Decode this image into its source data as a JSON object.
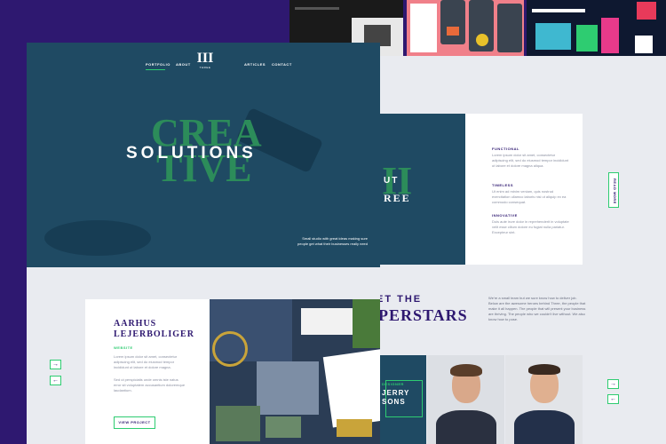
{
  "nav": {
    "portfolio": "PORTFOLIO",
    "about": "ABOUT",
    "articles": "ARTICLES",
    "contact": "CONTACT",
    "logo_mark": "III",
    "logo_text": "THREE"
  },
  "hero": {
    "headline": "SOLUTIONS",
    "bg_word_1": "CREA",
    "bg_word_2": "TIVE",
    "tagline": "Small studio with great ideas making sure people get what their businesses really need"
  },
  "about": {
    "partial_heading_1": "UT",
    "partial_heading_2": "REE",
    "items": [
      {
        "title": "FUNCTIONAL",
        "body": "Lorem ipsum dolor sit amet, consectetur adipiscing elit, sed do eiusmod tempor incididunt ut labore et dolore magna aliqua."
      },
      {
        "title": "TIMELESS",
        "body": "Ut enim ad minim veniam, quis nostrud exercitation ullamco laboris nisi ut aliquip ex ea commodo consequat."
      },
      {
        "title": "INNOVATIVE",
        "body": "Duis aute irure dolor in reprehenderit in voluptate velit esse cillum dolore eu fugiat nulla pariatur. Excepteur sint."
      }
    ],
    "read_more": "READ MORE"
  },
  "project": {
    "title_line1": "AARHUS",
    "title_line2": "LEJERBOLIGER",
    "category": "WEBSITE",
    "body1": "Lorem ipsum dolor sit amet, consectetur adipiscing elit, sed do eiusmod tempor incididunt ut labore et dolore magna.",
    "body2": "Sed ut perspiciatis unde omnis iste natus error sit voluptatem accusantium doloremque laudantium.",
    "view_label": "VIEW PROJECT"
  },
  "team": {
    "heading_line1": "ET THE",
    "heading_line2": "PERSTARS",
    "intro": "We're a small team but we sure know how to deliver job. Below are the awesome heroes behind Three, the people that make it all happen. The people that will present your business are thriving. The people who we couldn't live without. We also know how to pose.",
    "member_label_1": "DESIGNER",
    "member_name": "JERRY",
    "member_name_2": "SONS"
  },
  "arrows": {
    "next": "→",
    "prev": "←"
  },
  "colors": {
    "brand_purple": "#2e1870",
    "accent_green": "#2ecc71",
    "hero_teal": "#1f4a63",
    "gold": "#c9a43a"
  }
}
